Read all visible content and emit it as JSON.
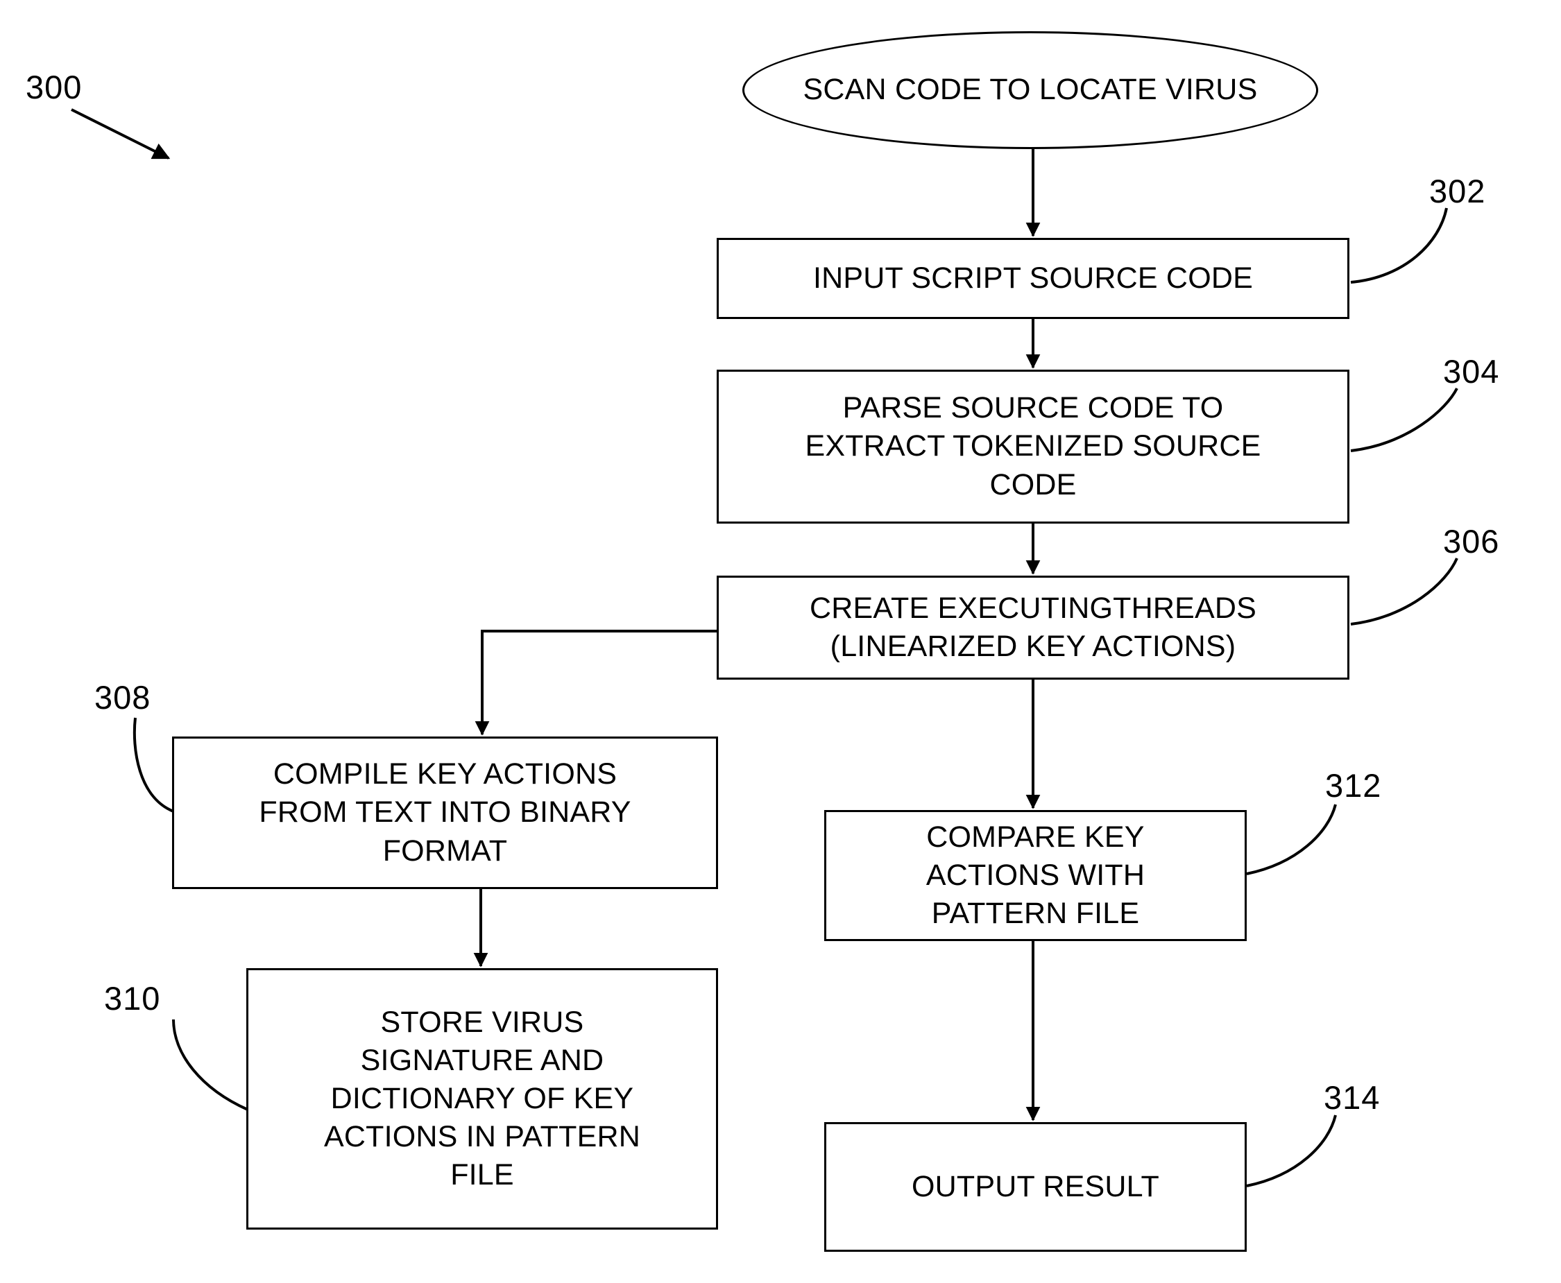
{
  "figure": {
    "ref_number": "300",
    "type": "patent-flowchart"
  },
  "nodes": {
    "start": {
      "label": "SCAN CODE TO LOCATE VIRUS",
      "shape": "oval"
    },
    "step_302": {
      "label": "INPUT SCRIPT SOURCE CODE",
      "ref": "302",
      "shape": "rectangle"
    },
    "step_304": {
      "label": "PARSE SOURCE CODE TO\nEXTRACT TOKENIZED SOURCE\nCODE",
      "ref": "304",
      "shape": "rectangle"
    },
    "step_306": {
      "label": "CREATE EXECUTINGTHREADS\n(LINEARIZED KEY ACTIONS)",
      "ref": "306",
      "shape": "rectangle"
    },
    "step_308": {
      "label": "COMPILE KEY ACTIONS\nFROM TEXT INTO BINARY\nFORMAT",
      "ref": "308",
      "shape": "rectangle"
    },
    "step_310": {
      "label": "STORE VIRUS\nSIGNATURE AND\nDICTIONARY OF KEY\nACTIONS IN PATTERN\nFILE",
      "ref": "310",
      "shape": "rectangle"
    },
    "step_312": {
      "label": "COMPARE KEY\nACTIONS WITH\nPATTERN FILE",
      "ref": "312",
      "shape": "rectangle"
    },
    "step_314": {
      "label": "OUTPUT RESULT",
      "ref": "314",
      "shape": "rectangle"
    }
  },
  "colors": {
    "stroke": "#000000",
    "background": "#ffffff"
  }
}
